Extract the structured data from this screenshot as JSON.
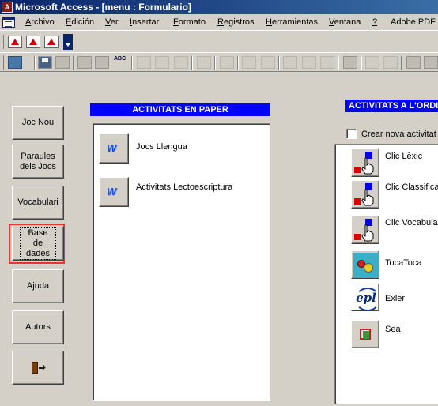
{
  "window": {
    "title": "Microsoft Access - [menu : Formulario]",
    "app_icon": "A"
  },
  "menubar": {
    "doc_icon": "form-document-icon",
    "items": [
      {
        "label": "Archivo",
        "accel": "A",
        "rest": "rchivo"
      },
      {
        "label": "Edición",
        "accel": "E",
        "rest": "dición"
      },
      {
        "label": "Ver",
        "accel": "V",
        "rest": "er"
      },
      {
        "label": "Insertar",
        "accel": "I",
        "rest": "nsertar"
      },
      {
        "label": "Formato",
        "accel": "F",
        "rest": "ormato"
      },
      {
        "label": "Registros",
        "accel": "R",
        "rest": "egistros"
      },
      {
        "label": "Herramientas",
        "accel": "H",
        "rest": "erramientas"
      },
      {
        "label": "Ventana",
        "accel": "V",
        "rest": "entana"
      },
      {
        "label": "?",
        "accel": "?",
        "rest": ""
      },
      {
        "label": "Adobe PDF",
        "accel": "",
        "rest": "Adobe PDF"
      }
    ]
  },
  "toolbar1": {
    "icons": [
      "pdf-convert-icon",
      "pdf-email-icon",
      "pdf-review-icon"
    ]
  },
  "toolbar2": {
    "icons": [
      "design-view-icon",
      "save-icon",
      "search-file-icon",
      "print-icon",
      "print-preview-icon",
      "spelling-icon",
      "cut-icon",
      "copy-icon",
      "paste-icon",
      "undo-icon",
      "hyperlink-icon",
      "sort-asc-icon",
      "sort-desc-icon",
      "filter-selection-icon",
      "filter-form-icon",
      "apply-filter-icon",
      "find-icon",
      "new-record-icon",
      "delete-record-icon",
      "properties-icon",
      "database-window-icon"
    ],
    "spelling_label": "ABC"
  },
  "nav": {
    "buttons": [
      {
        "id": "joc-nou",
        "label": "Joc Nou"
      },
      {
        "id": "paraules",
        "label": "Paraules dels Jocs"
      },
      {
        "id": "vocabulari",
        "label": "Vocabulari"
      },
      {
        "id": "base-de-dades",
        "label": "Base de dades"
      },
      {
        "id": "ajuda",
        "label": "Ajuda"
      },
      {
        "id": "autors",
        "label": "Autors"
      }
    ],
    "exit_icon": "exit-door-icon"
  },
  "paper": {
    "header": "ACTIVITATS EN PAPER",
    "items": [
      {
        "label": "Jocs Llengua",
        "icon": "word-icon"
      },
      {
        "label": "Activitats Lectoescriptura",
        "icon": "word-icon"
      }
    ]
  },
  "ordinador": {
    "header": "ACTIVITATS A L'ORDINADOR",
    "checkbox_label": "Crear nova activitat",
    "checkbox_checked": false,
    "items": [
      {
        "label": "Clic Lèxic",
        "icon": "clic-icon"
      },
      {
        "label": "Clic Classifica",
        "icon": "clic-icon"
      },
      {
        "label": "Clic Vocabulari",
        "icon": "clic-icon"
      },
      {
        "label": "TocaToca",
        "icon": "tocatoca-icon"
      },
      {
        "label": "Exler",
        "icon": "exler-icon"
      },
      {
        "label": "Sea",
        "icon": "sea-icon"
      }
    ]
  },
  "colors": {
    "header_blue": "#0000ff",
    "titlebar": "#0a246a",
    "focus_highlight": "#e8352e",
    "face": "#d4d0c8"
  }
}
